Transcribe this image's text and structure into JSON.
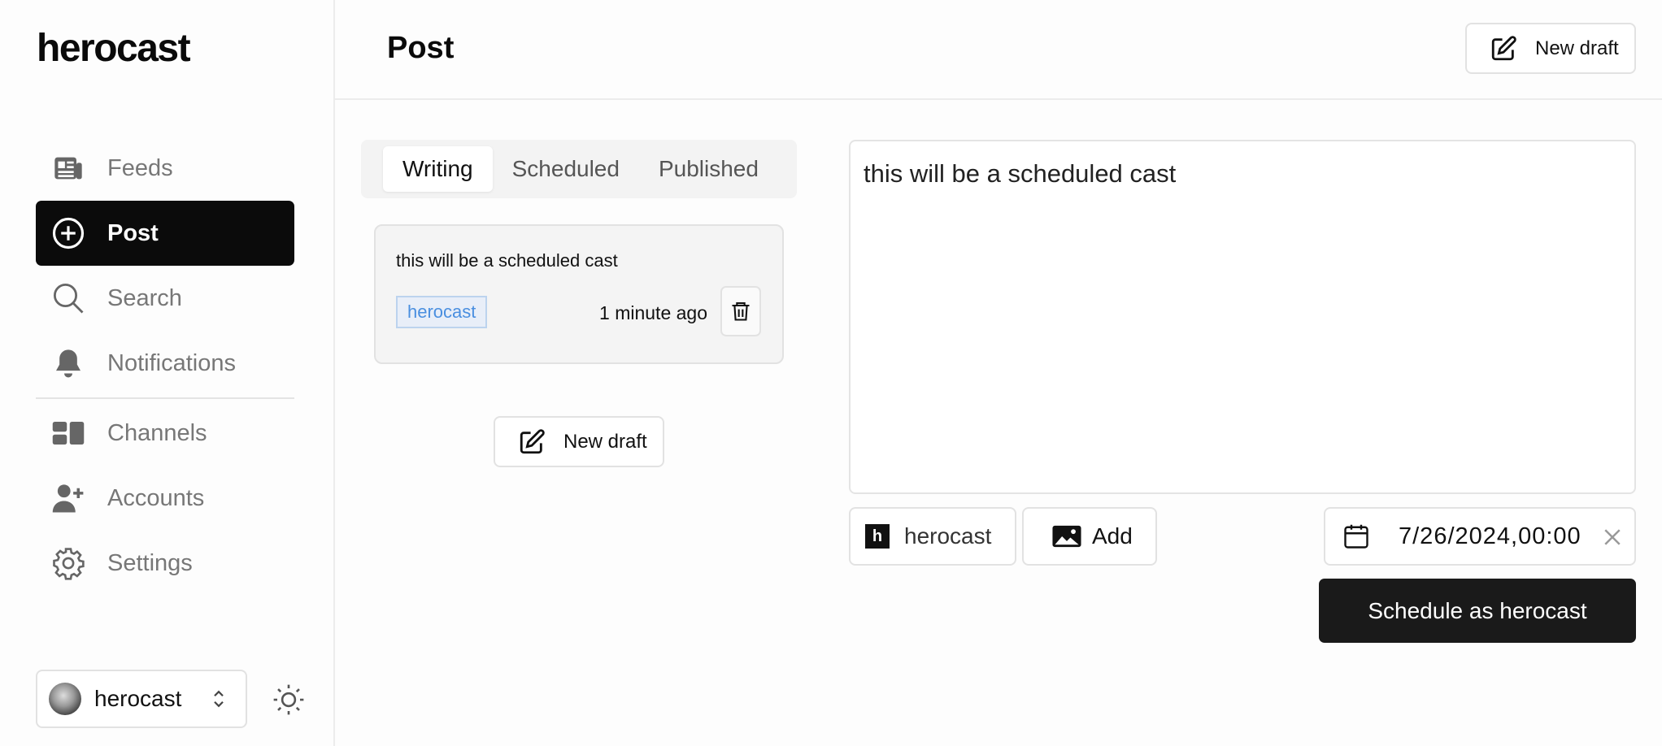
{
  "sidebar": {
    "brand": "herocast",
    "items": [
      {
        "label": "Feeds",
        "icon": "newspaper-icon"
      },
      {
        "label": "Post",
        "icon": "plus-circle-icon",
        "active": true
      },
      {
        "label": "Search",
        "icon": "search-icon"
      },
      {
        "label": "Notifications",
        "icon": "bell-icon"
      },
      {
        "label": "Channels",
        "icon": "channels-icon"
      },
      {
        "label": "Accounts",
        "icon": "user-plus-icon"
      },
      {
        "label": "Settings",
        "icon": "gear-icon"
      }
    ],
    "account": {
      "name": "herocast"
    }
  },
  "header": {
    "title": "Post",
    "new_draft_label": "New draft"
  },
  "drafts": {
    "tabs": [
      "Writing",
      "Scheduled",
      "Published"
    ],
    "active_tab": "Writing",
    "items": [
      {
        "text": "this will be a scheduled cast",
        "channel": "herocast",
        "time": "1 minute ago"
      }
    ],
    "new_draft_label": "New draft"
  },
  "editor": {
    "text": "this will be a scheduled cast",
    "channel": {
      "initial": "h",
      "name": "herocast"
    },
    "add_label": "Add",
    "date_value": "7/26/2024,00:00",
    "submit_label": "Schedule as herocast"
  },
  "colors": {
    "primary": "#0b0b0b",
    "tag_text": "#4a8fe0",
    "tag_bg": "#e8eef8",
    "muted_text": "#777777"
  }
}
